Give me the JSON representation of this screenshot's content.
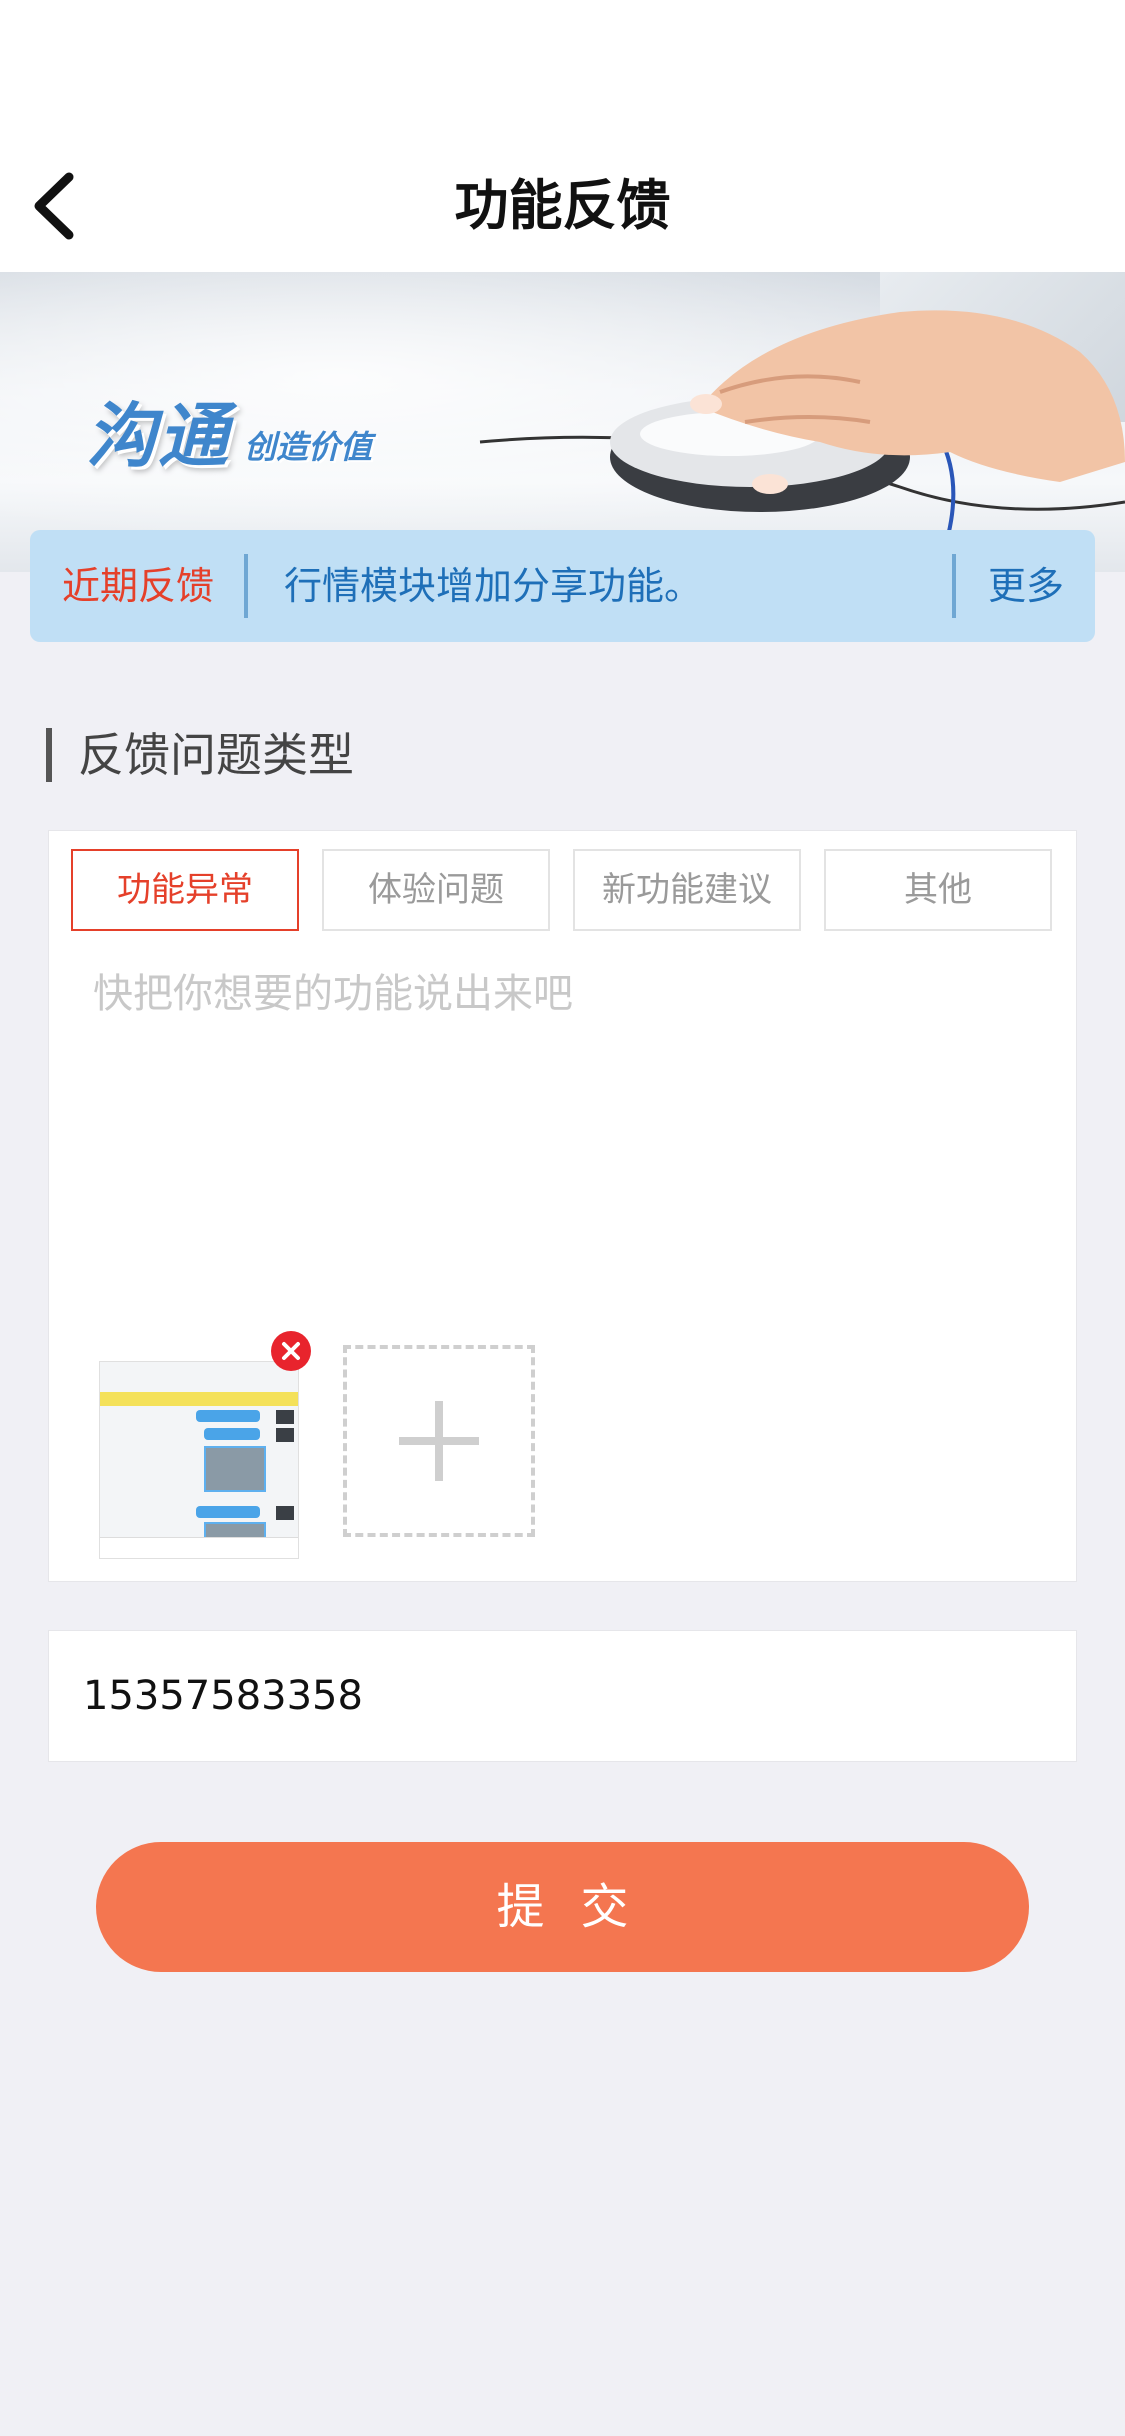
{
  "nav": {
    "title": "功能反馈",
    "back_icon": "chevron-left-icon"
  },
  "banner": {
    "slogan_main": "沟通",
    "slogan_sub": "创造价值"
  },
  "notice": {
    "label": "近期反馈",
    "text": "行情模块增加分享功能。",
    "more": "更多"
  },
  "section": {
    "title": "反馈问题类型"
  },
  "feedback": {
    "types": [
      {
        "label": "功能异常",
        "active": true
      },
      {
        "label": "体验问题",
        "active": false
      },
      {
        "label": "新功能建议",
        "active": false
      },
      {
        "label": "其他",
        "active": false
      }
    ],
    "placeholder": "快把你想要的功能说出来吧",
    "value": ""
  },
  "phone": {
    "value": "15357583358"
  },
  "submit": {
    "label": "提交"
  },
  "colors": {
    "accent_red": "#e5402a",
    "notice_blue": "#1e6fb8",
    "notice_bg": "#c0dff5",
    "submit_orange": "#f47650",
    "page_bg": "#f0f0f5"
  }
}
